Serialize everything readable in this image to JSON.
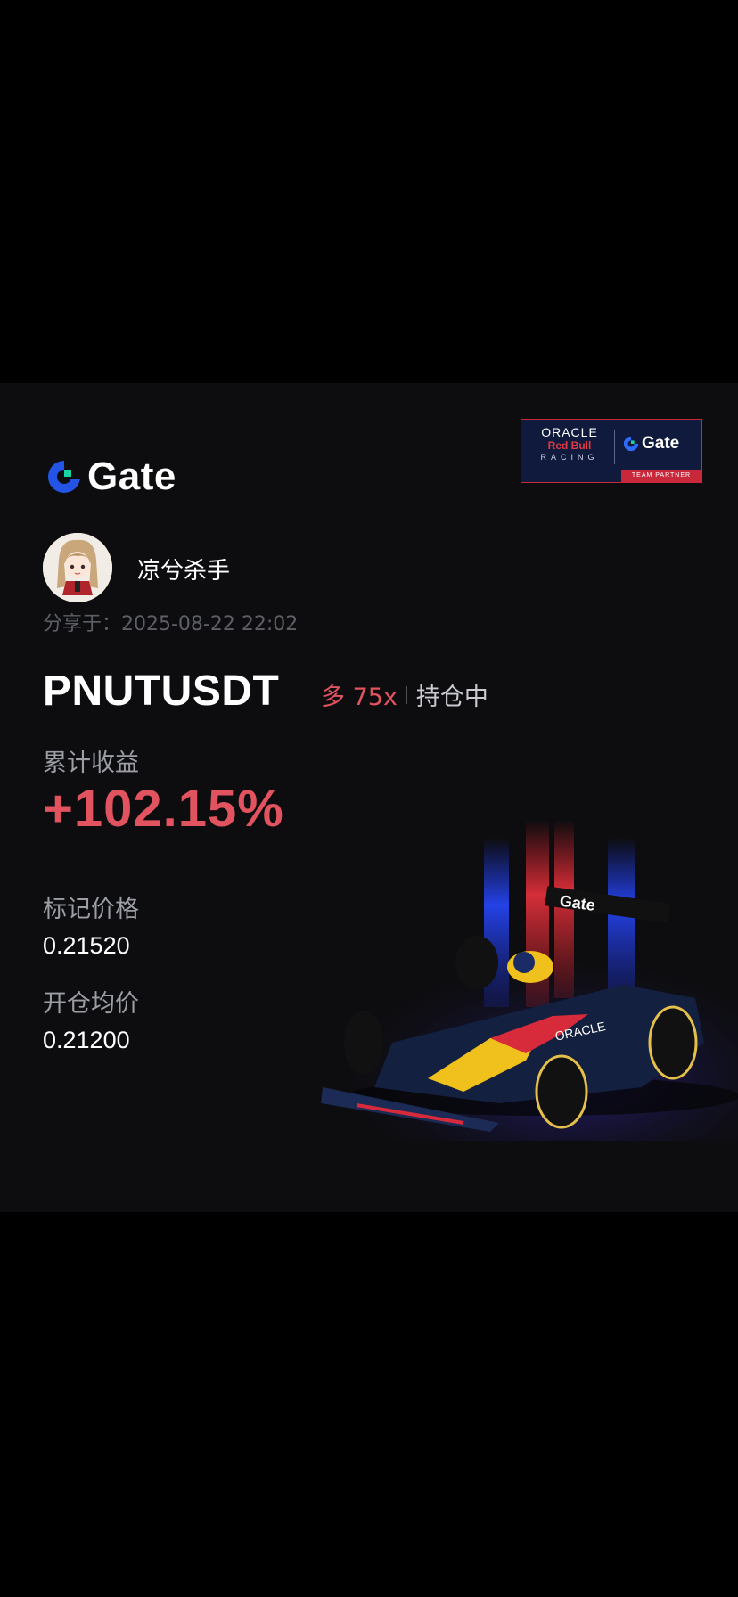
{
  "brand": {
    "name": "Gate",
    "accent_color": "#2354e6",
    "accent_secondary": "#19d3a0"
  },
  "partner_badge": {
    "oracle": "ORACLE",
    "redbull": "Red Bull",
    "racing": "RACING",
    "gate": "Gate",
    "team_partner": "TEAM PARTNER"
  },
  "user": {
    "name": "凉兮杀手",
    "share_time": "分享于：2025-08-22 22:02"
  },
  "position": {
    "pair": "PNUTUSDT",
    "side_leverage": "多 75x",
    "status": "持仓中"
  },
  "pnl": {
    "label": "累计收益",
    "value": "+102.15%",
    "color": "#e0535f"
  },
  "mark_price": {
    "label": "标记价格",
    "value": "0.21520"
  },
  "entry_price": {
    "label": "开仓均价",
    "value": "0.21200"
  },
  "car": {
    "wing_text": "Gate",
    "sidepod_text": "ORACLE"
  }
}
